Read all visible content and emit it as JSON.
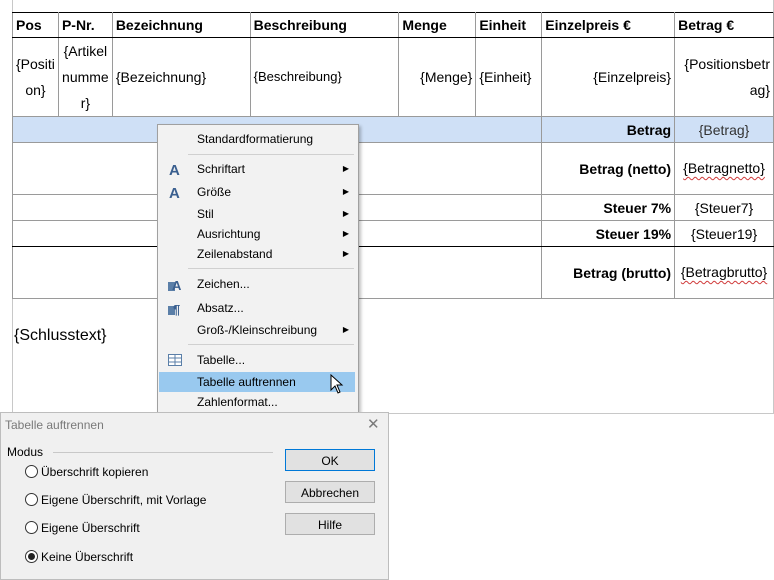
{
  "table": {
    "headers": [
      "Pos",
      "P-Nr.",
      "Bezeichnung",
      "Beschreibung",
      "Menge",
      "Einheit",
      "Einzelpreis €",
      "Betrag  €"
    ],
    "row": {
      "pos": "{Position}",
      "pnr": "{Artikelnummer}",
      "bezeichnung": "{Bezeichnung}",
      "beschreibung": "{Beschreibung}",
      "menge": "{Menge}",
      "einheit": "{Einheit}",
      "einzelpreis": "{Einzelpreis}",
      "betrag": "{Positionsbetrag}"
    },
    "totals": [
      {
        "label": "Betrag",
        "value": "{Betrag}"
      },
      {
        "label": "Betrag (netto)",
        "value": "{Betragnetto}"
      },
      {
        "label": "Steuer 7%",
        "value": "{Steuer7}"
      },
      {
        "label": "Steuer 19%",
        "value": "{Steuer19}"
      },
      {
        "label": "Betrag (brutto)",
        "value": "{Betragbrutto}"
      }
    ]
  },
  "schlusstext": "{Schlusstext}",
  "context_menu": {
    "items": [
      {
        "label": "Standardformatierung",
        "submenu": false
      },
      {
        "label": "Schriftart",
        "submenu": true,
        "icon": "font-icon"
      },
      {
        "label": "Größe",
        "submenu": true,
        "icon": "font-size-icon"
      },
      {
        "label": "Stil",
        "submenu": true
      },
      {
        "label": "Ausrichtung",
        "submenu": true
      },
      {
        "label": "Zeilenabstand",
        "submenu": true
      },
      {
        "label": "Zeichen...",
        "submenu": false,
        "icon": "character-icon"
      },
      {
        "label": "Absatz...",
        "submenu": false,
        "icon": "paragraph-icon"
      },
      {
        "label": "Groß-/Kleinschreibung",
        "submenu": true
      },
      {
        "label": "Tabelle...",
        "submenu": false,
        "icon": "table-icon"
      },
      {
        "label": "Tabelle auftrennen",
        "submenu": false,
        "highlighted": true
      },
      {
        "label": "Zahlenformat...",
        "submenu": false
      }
    ]
  },
  "dialog": {
    "title": "Tabelle auftrennen",
    "group_label": "Modus",
    "options": [
      {
        "label": "Überschrift kopieren",
        "selected": false
      },
      {
        "label": "Eigene Überschrift, mit Vorlage",
        "selected": false
      },
      {
        "label": "Eigene Überschrift",
        "selected": false
      },
      {
        "label": "Keine Überschrift",
        "selected": true
      }
    ],
    "buttons": {
      "ok": "OK",
      "cancel": "Abbrechen",
      "help": "Hilfe"
    }
  },
  "colors": {
    "selection": "#cfe0f6",
    "menu_highlight": "#99c9ef",
    "dialog_bg": "#f0f0f0"
  }
}
